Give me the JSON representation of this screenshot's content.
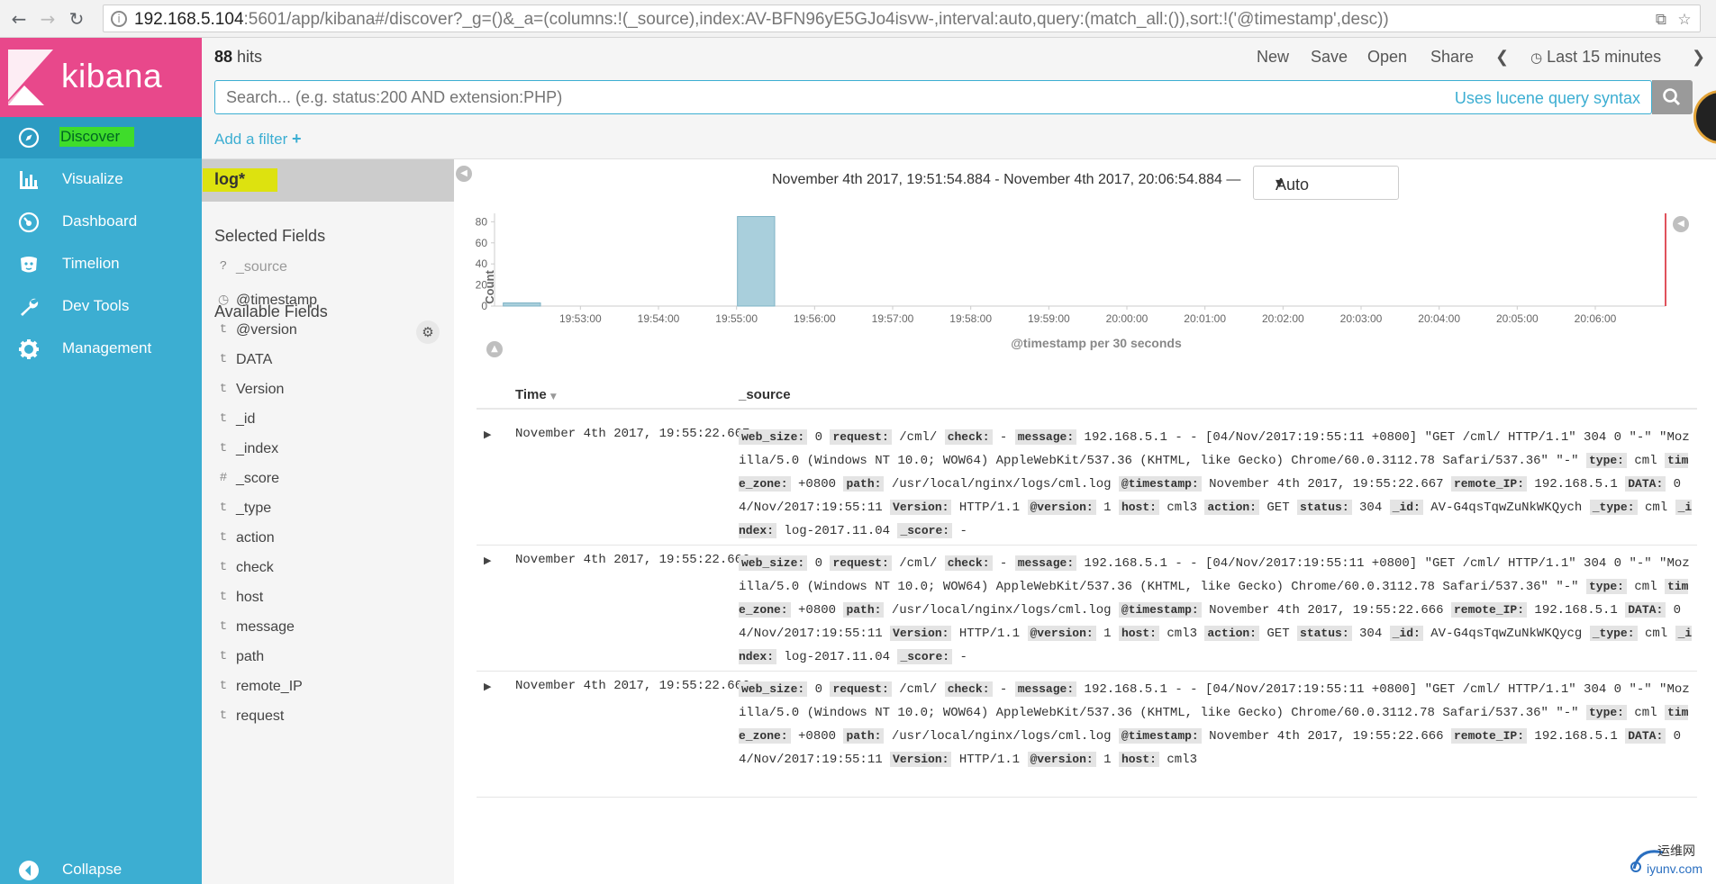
{
  "browser": {
    "url_host": "192.168.5.104",
    "url_rest": ":5601/app/kibana#/discover?_g=()&_a=(columns:!(_source),index:AV-BFN96yE5GJo4isvw-,interval:auto,query:(match_all:()),sort:!('@timestamp',desc))"
  },
  "sidebar": {
    "logo": "kibana",
    "items": [
      {
        "label": "Discover",
        "icon": "compass-icon"
      },
      {
        "label": "Visualize",
        "icon": "bar-chart-icon"
      },
      {
        "label": "Dashboard",
        "icon": "dashboard-icon"
      },
      {
        "label": "Timelion",
        "icon": "timelion-icon"
      },
      {
        "label": "Dev Tools",
        "icon": "wrench-icon"
      },
      {
        "label": "Management",
        "icon": "gear-icon"
      }
    ],
    "collapse": "Collapse"
  },
  "topbar": {
    "hits_count": "88",
    "hits_label": "hits",
    "menu": {
      "new": "New",
      "save": "Save",
      "open": "Open",
      "share": "Share",
      "time": "Last 15 minutes"
    }
  },
  "search": {
    "placeholder": "Search... (e.g. status:200 AND extension:PHP)",
    "syntax_link": "Uses lucene query syntax"
  },
  "filter": {
    "add_label": "Add a filter"
  },
  "fields": {
    "index_pattern": "log*",
    "selected_title": "Selected Fields",
    "selected": [
      {
        "type": "?",
        "name": "_source"
      }
    ],
    "available_title": "Available Fields",
    "available": [
      {
        "type": "clock",
        "name": "@timestamp"
      },
      {
        "type": "t",
        "name": "@version"
      },
      {
        "type": "t",
        "name": "DATA"
      },
      {
        "type": "t",
        "name": "Version"
      },
      {
        "type": "t",
        "name": "_id"
      },
      {
        "type": "t",
        "name": "_index"
      },
      {
        "type": "#",
        "name": "_score"
      },
      {
        "type": "t",
        "name": "_type"
      },
      {
        "type": "t",
        "name": "action"
      },
      {
        "type": "t",
        "name": "check"
      },
      {
        "type": "t",
        "name": "host"
      },
      {
        "type": "t",
        "name": "message"
      },
      {
        "type": "t",
        "name": "path"
      },
      {
        "type": "t",
        "name": "remote_IP"
      },
      {
        "type": "t",
        "name": "request"
      }
    ]
  },
  "histogram": {
    "range_text": "November 4th 2017, 19:51:54.884 - November 4th 2017, 20:06:54.884 —",
    "interval": "Auto"
  },
  "chart_data": {
    "type": "bar",
    "xlabel": "@timestamp per 30 seconds",
    "ylabel": "Count",
    "ylim": [
      0,
      88
    ],
    "yticks": [
      0,
      20,
      40,
      60,
      80
    ],
    "xlim": [
      "19:51:54",
      "20:06:54"
    ],
    "xticks": [
      "19:53:00",
      "19:54:00",
      "19:55:00",
      "19:56:00",
      "19:57:00",
      "19:58:00",
      "19:59:00",
      "20:00:00",
      "20:01:00",
      "20:02:00",
      "20:03:00",
      "20:04:00",
      "20:05:00",
      "20:06:00"
    ],
    "bars": [
      {
        "x": "19:52:00",
        "value": 3
      },
      {
        "x": "19:55:00",
        "value": 85
      }
    ],
    "grid": false
  },
  "table": {
    "columns": [
      "Time",
      "_source"
    ],
    "rows": [
      {
        "time": "November 4th 2017, 19:55:22.667",
        "source": [
          [
            "web_size:",
            "0"
          ],
          [
            "request:",
            "/cml/"
          ],
          [
            "check:",
            "-"
          ],
          [
            "message:",
            "192.168.5.1 - - [04/Nov/2017:19:55:11 +0800] \"GET /cml/ HTTP/1.1\" 304 0 \"-\" \"Mozilla/5.0 (Windows NT 10.0; WOW64) AppleWebKit/537.36 (KHTML, like Gecko) Chrome/60.0.3112.78 Safari/537.36\" \"-\""
          ],
          [
            "type:",
            "cml"
          ],
          [
            "time_zone:",
            "+0800"
          ],
          [
            "path:",
            "/usr/local/nginx/logs/cml.log"
          ],
          [
            "@timestamp:",
            "November 4th 2017, 19:55:22.667"
          ],
          [
            "remote_IP:",
            "192.168.5.1"
          ],
          [
            "DATA:",
            "04/Nov/2017:19:55:11"
          ],
          [
            "Version:",
            "HTTP/1.1"
          ],
          [
            "@version:",
            "1"
          ],
          [
            "host:",
            "cml3"
          ],
          [
            "action:",
            "GET"
          ],
          [
            "status:",
            "304"
          ],
          [
            "_id:",
            "AV-G4qsTqwZuNkWKQych"
          ],
          [
            "_type:",
            "cml"
          ],
          [
            "_index:",
            "log-2017.11.04"
          ],
          [
            "_score:",
            "-"
          ]
        ]
      },
      {
        "time": "November 4th 2017, 19:55:22.666",
        "source": [
          [
            "web_size:",
            "0"
          ],
          [
            "request:",
            "/cml/"
          ],
          [
            "check:",
            "-"
          ],
          [
            "message:",
            "192.168.5.1 - - [04/Nov/2017:19:55:11 +0800] \"GET /cml/ HTTP/1.1\" 304 0 \"-\" \"Mozilla/5.0 (Windows NT 10.0; WOW64) AppleWebKit/537.36 (KHTML, like Gecko) Chrome/60.0.3112.78 Safari/537.36\" \"-\""
          ],
          [
            "type:",
            "cml"
          ],
          [
            "time_zone:",
            "+0800"
          ],
          [
            "path:",
            "/usr/local/nginx/logs/cml.log"
          ],
          [
            "@timestamp:",
            "November 4th 2017, 19:55:22.666"
          ],
          [
            "remote_IP:",
            "192.168.5.1"
          ],
          [
            "DATA:",
            "04/Nov/2017:19:55:11"
          ],
          [
            "Version:",
            "HTTP/1.1"
          ],
          [
            "@version:",
            "1"
          ],
          [
            "host:",
            "cml3"
          ],
          [
            "action:",
            "GET"
          ],
          [
            "status:",
            "304"
          ],
          [
            "_id:",
            "AV-G4qsTqwZuNkWKQycg"
          ],
          [
            "_type:",
            "cml"
          ],
          [
            "_index:",
            "log-2017.11.04"
          ],
          [
            "_score:",
            "-"
          ]
        ]
      },
      {
        "time": "November 4th 2017, 19:55:22.666",
        "source": [
          [
            "web_size:",
            "0"
          ],
          [
            "request:",
            "/cml/"
          ],
          [
            "check:",
            "-"
          ],
          [
            "message:",
            "192.168.5.1 - - [04/Nov/2017:19:55:11 +0800] \"GET /cml/ HTTP/1.1\" 304 0 \"-\" \"Mozilla/5.0 (Windows NT 10.0; WOW64) AppleWebKit/537.36 (KHTML, like Gecko) Chrome/60.0.3112.78 Safari/537.36\" \"-\""
          ],
          [
            "type:",
            "cml"
          ],
          [
            "time_zone:",
            "+0800"
          ],
          [
            "path:",
            "/usr/local/nginx/logs/cml.log"
          ],
          [
            "@timestamp:",
            "November 4th 2017, 19:55:22.666"
          ],
          [
            "remote_IP:",
            "192.168.5.1"
          ],
          [
            "DATA:",
            "04/Nov/2017:19:55:11"
          ],
          [
            "Version:",
            "HTTP/1.1"
          ],
          [
            "@version:",
            "1"
          ],
          [
            "host:",
            "cml3"
          ]
        ]
      }
    ]
  },
  "watermark": {
    "line1": "运维网",
    "line2": "iyunv.com"
  },
  "colors": {
    "sidebar": "#3caed2",
    "logo": "#e8488b",
    "accent": "#3caed2",
    "bar": "#a9cfdc",
    "marker": "#e0525c"
  }
}
